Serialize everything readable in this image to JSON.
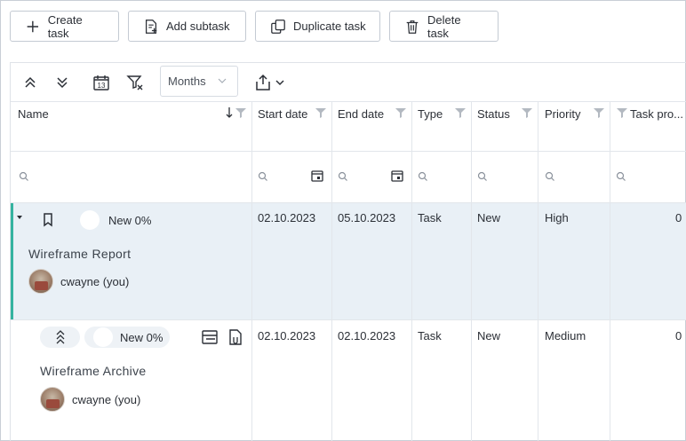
{
  "actions": {
    "create": "Create task",
    "add_subtask": "Add subtask",
    "duplicate": "Duplicate task",
    "delete": "Delete task"
  },
  "toolbar": {
    "calendar_day": "13",
    "scale_value": "Months"
  },
  "columns": {
    "name": "Name",
    "start": "Start date",
    "end": "End date",
    "type": "Type",
    "status": "Status",
    "priority": "Priority",
    "progress": "Task pro..."
  },
  "rows": [
    {
      "status_pill": "New 0%",
      "name": "Wireframe Report",
      "user": "cwayne (you)",
      "start": "02.10.2023",
      "end": "05.10.2023",
      "type": "Task",
      "status": "New",
      "priority": "High",
      "progress": "0"
    },
    {
      "status_pill": "New 0%",
      "name": "Wireframe Archive",
      "user": "cwayne (you)",
      "start": "02.10.2023",
      "end": "02.10.2023",
      "type": "Task",
      "status": "New",
      "priority": "Medium",
      "progress": "0"
    }
  ],
  "colors": {
    "accent": "#35b3a0",
    "selected_row": "#e9f0f6"
  }
}
